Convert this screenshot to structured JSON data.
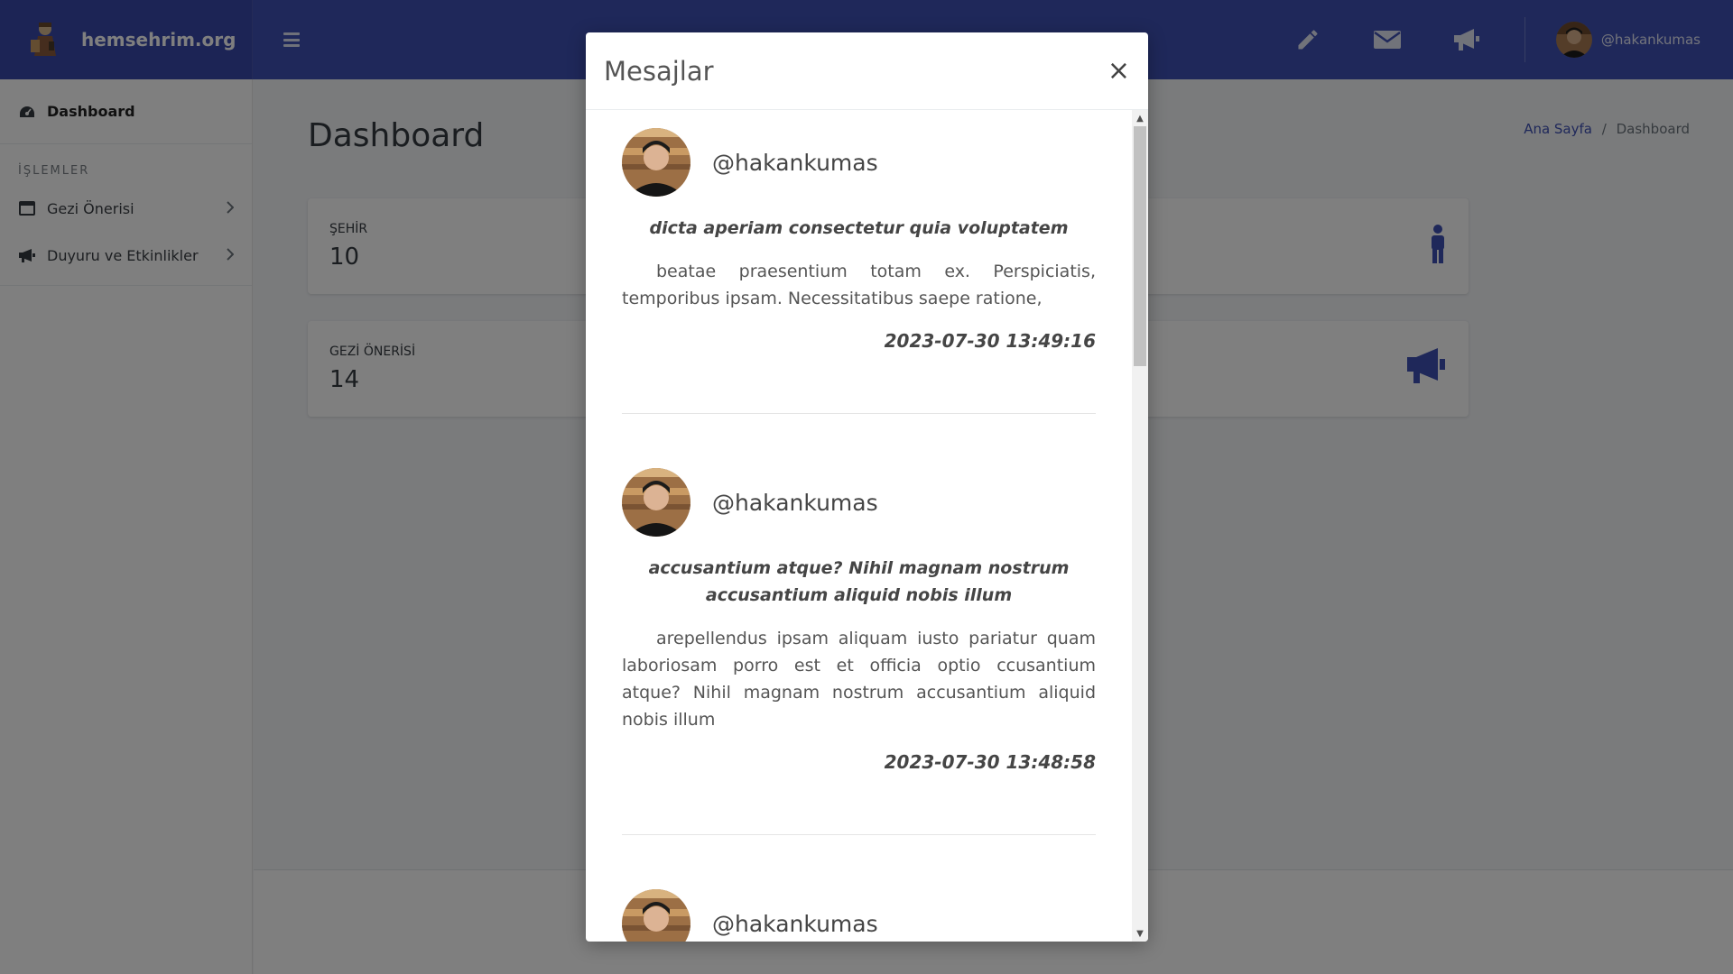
{
  "header": {
    "brand": "hemsehrim.org",
    "username": "@hakankumas"
  },
  "sidebar": {
    "dashboard": "Dashboard",
    "section_heading": "İŞLEMLER",
    "items": [
      {
        "label": "Gezi Önerisi"
      },
      {
        "label": "Duyuru ve Etkinlikler"
      }
    ]
  },
  "main": {
    "title": "Dashboard",
    "breadcrumb": {
      "home": "Ana Sayfa",
      "separator": "/",
      "current": "Dashboard"
    },
    "cards": [
      {
        "label": "ŞEHİR",
        "value": "10",
        "icon": "person-icon"
      },
      {
        "label": "GEZİ ÖNERİSİ",
        "value": "14",
        "icon": "megaphone-icon"
      }
    ]
  },
  "modal": {
    "title": "Mesajlar",
    "close": "×",
    "messages": [
      {
        "user": "@hakankumas",
        "subject": "dicta aperiam consectetur quia voluptatem",
        "text": "beatae praesentium totam ex. Perspiciatis, temporibus ipsam. Necessitatibus saepe ratione,",
        "date": "2023-07-30 13:49:16"
      },
      {
        "user": "@hakankumas",
        "subject": "accusantium atque? Nihil magnam nostrum accusantium aliquid nobis illum",
        "text": "arepellendus ipsam aliquam iusto pariatur quam laboriosam porro est et officia optio ccusantium atque? Nihil magnam nostrum accusantium aliquid nobis illum",
        "date": "2023-07-30 13:48:58"
      },
      {
        "user": "@hakankumas"
      }
    ]
  },
  "colors": {
    "primary": "#3f51b5",
    "brand_bg": "#3949ab",
    "overlay": "rgba(0,0,0,0.5)"
  }
}
